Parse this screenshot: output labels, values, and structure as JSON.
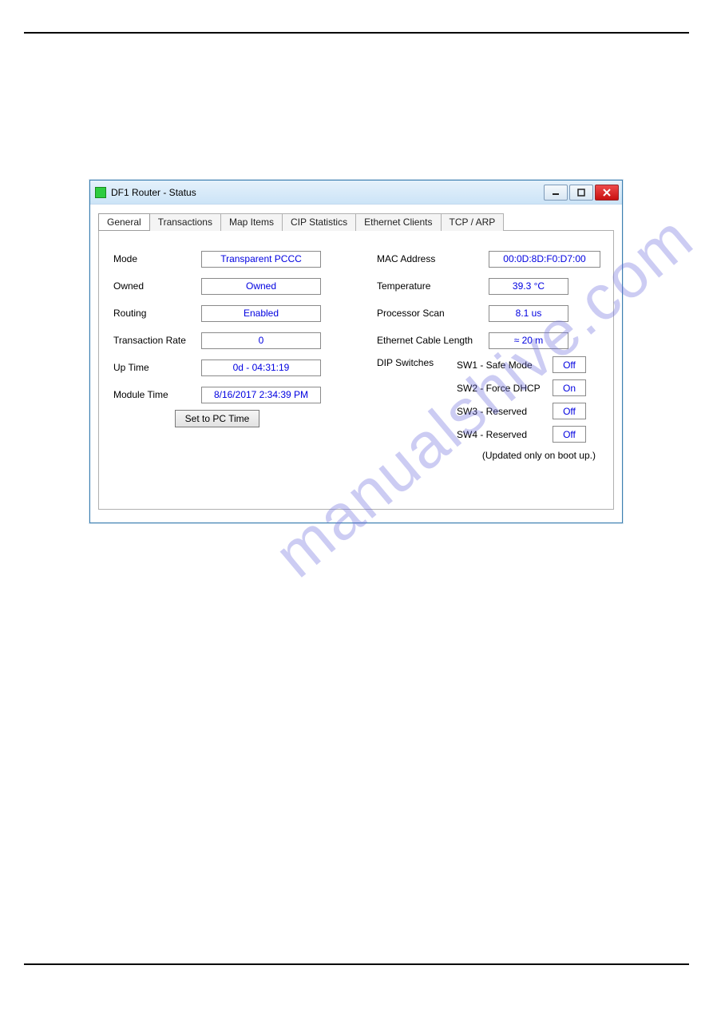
{
  "watermark": "manualshive.com",
  "window": {
    "title": "DF1 Router - Status"
  },
  "tabs": {
    "general": "General",
    "transactions": "Transactions",
    "map_items": "Map Items",
    "cip_stats": "CIP Statistics",
    "eth_clients": "Ethernet Clients",
    "tcp_arp": "TCP / ARP"
  },
  "left": {
    "mode_lbl": "Mode",
    "mode_val": "Transparent PCCC",
    "owned_lbl": "Owned",
    "owned_val": "Owned",
    "routing_lbl": "Routing",
    "routing_val": "Enabled",
    "txrate_lbl": "Transaction Rate",
    "txrate_val": "0",
    "uptime_lbl": "Up Time",
    "uptime_val": "0d - 04:31:19",
    "modtime_lbl": "Module Time",
    "modtime_val": "8/16/2017 2:34:39 PM",
    "setpc_btn": "Set to PC Time"
  },
  "right": {
    "mac_lbl": "MAC Address",
    "mac_val": "00:0D:8D:F0:D7:00",
    "temp_lbl": "Temperature",
    "temp_val": "39.3 °C",
    "scan_lbl": "Processor Scan",
    "scan_val": "8.1 us",
    "cable_lbl": "Ethernet Cable Length",
    "cable_val": "≈ 20 m",
    "dip_lbl": "DIP Switches",
    "sw1_lbl": "SW1 - Safe Mode",
    "sw1_val": "Off",
    "sw2_lbl": "SW2 - Force DHCP",
    "sw2_val": "On",
    "sw3_lbl": "SW3 - Reserved",
    "sw3_val": "Off",
    "sw4_lbl": "SW4 - Reserved",
    "sw4_val": "Off",
    "note": "(Updated only on boot up.)"
  }
}
